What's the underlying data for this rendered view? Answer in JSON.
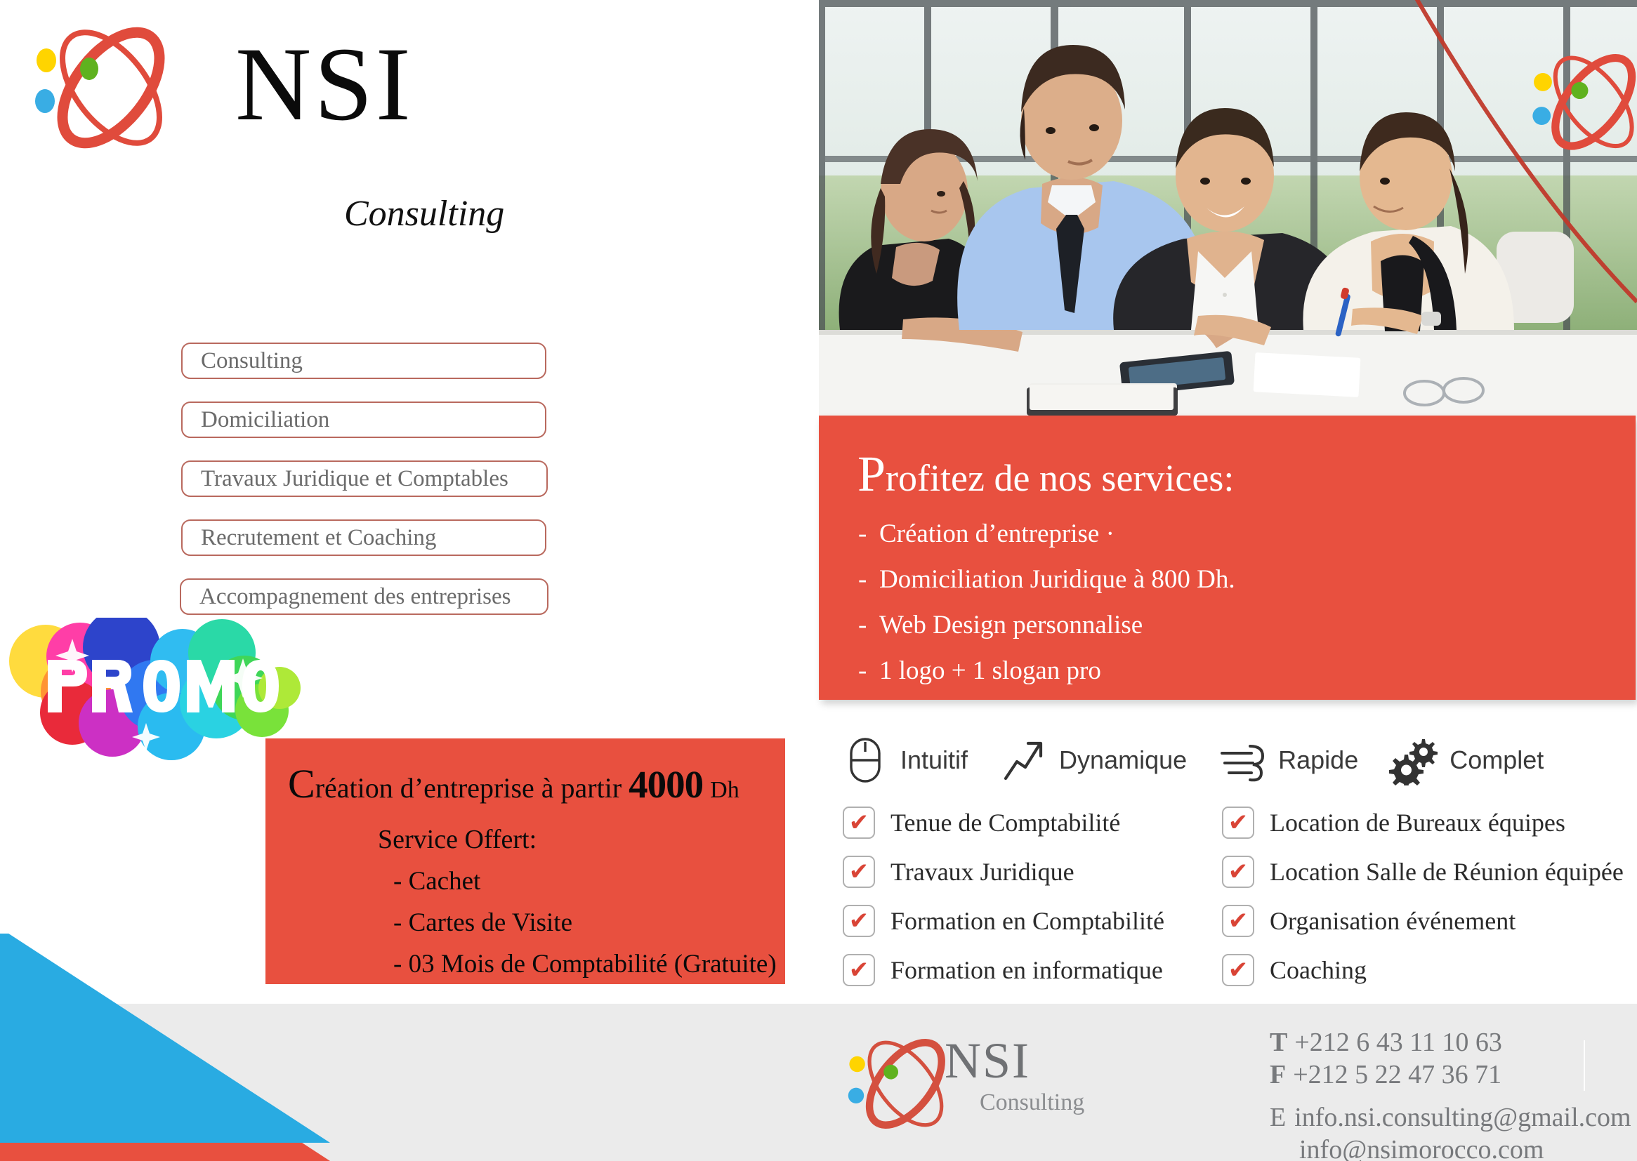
{
  "brand": {
    "name": "NSI",
    "tagline": "Consulting",
    "logo_icon": "atom-logo-icon",
    "colors": {
      "red": "#e8503f",
      "blue": "#29abe2",
      "yellow": "#ffd400",
      "green": "#5fb21f",
      "footer_gray": "#ebebeb",
      "box_border": "#b9695e"
    }
  },
  "services_list": [
    {
      "label": "Consulting"
    },
    {
      "label": "Domiciliation"
    },
    {
      "label": "Travaux Juridique et Comptables"
    },
    {
      "label": "Recrutement  et Coaching"
    },
    {
      "label": "Accompagnement des entreprises"
    }
  ],
  "promo": {
    "badge_text": "PROMO",
    "badge_icon": "promo-burst-icon"
  },
  "price_box": {
    "head_cap": "C",
    "head_rest": "réation d’entreprise à partir ",
    "amount": "4000",
    "unit": "Dh",
    "offer_title": "Service Offert:",
    "offers": [
      "- Cachet",
      "- Cartes de Visite",
      "- 03 Mois de Comptabilité (Gratuite)"
    ]
  },
  "photo": {
    "alt": "business-meeting-photo",
    "overlay_logo_icon": "atom-logo-icon"
  },
  "banner": {
    "title_cap": "P",
    "title_rest": "rofitez de nos services:",
    "items": [
      "Création d’entreprise ·",
      "Domiciliation Juridique à 800 Dh.",
      "Web Design personnalise",
      "1 logo + 1 slogan pro"
    ]
  },
  "features": [
    {
      "label": "Intuitif",
      "icon": "mouse-icon"
    },
    {
      "label": "Dynamique",
      "icon": "arrow-up-right-icon"
    },
    {
      "label": "Rapide",
      "icon": "speed-lines-icon"
    },
    {
      "label": "Complet",
      "icon": "gears-icon"
    }
  ],
  "checklist_left": [
    "Tenue de Comptabilité",
    "Travaux Juridique",
    "Formation en Comptabilité",
    "Formation en informatique"
  ],
  "checklist_right": [
    "Location de Bureaux équipes",
    "Location Salle de Réunion équipée",
    "Organisation événement",
    "Coaching"
  ],
  "footer": {
    "brand": "NSI",
    "tagline": "Consulting",
    "phone_key": "T",
    "phone": "+212 6 43 11 10 63",
    "fax_key": "F",
    "fax": "+212 5 22 47 36 71",
    "email_key": "E",
    "email1": "info.nsi.consulting@gmail.com",
    "email2": "info@nsimorocco.com"
  }
}
